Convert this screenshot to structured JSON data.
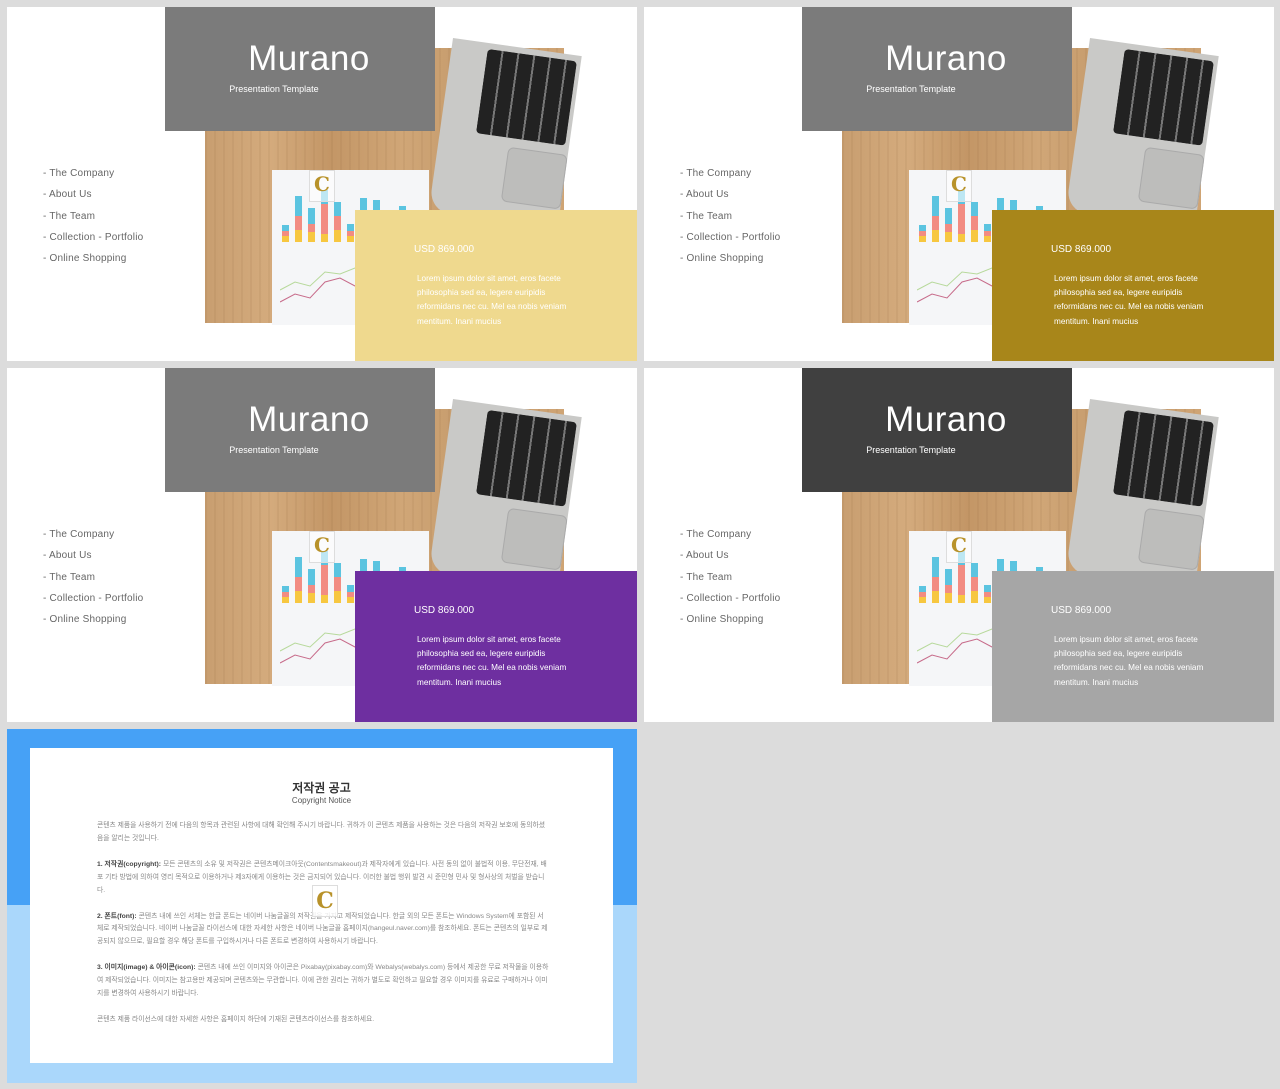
{
  "slides": [
    {
      "title": "Murano",
      "subtitle": "Presentation Template",
      "title_color": "#7b7b7b",
      "box_color": "#efd98e",
      "menu": [
        "- The Company",
        "- About Us",
        "- The Team",
        "- Collection - Portfolio",
        "- Online Shopping"
      ],
      "price": "USD 869.000",
      "description": "Lorem ipsum dolor sit amet, eros facete philosophia sed ea, legere euripidis reformidans nec cu. Mel ea nobis veniam mentitum. Inani mucius",
      "logo": "C"
    },
    {
      "title": "Murano",
      "subtitle": "Presentation Template",
      "title_color": "#7b7b7b",
      "box_color": "#a8861a",
      "menu": [
        "- The Company",
        "- About Us",
        "- The Team",
        "- Collection - Portfolio",
        "- Online Shopping"
      ],
      "price": "USD 869.000",
      "description": "Lorem ipsum dolor sit amet, eros facete philosophia sed ea, legere euripidis reformidans nec cu. Mel ea nobis veniam mentitum. Inani mucius",
      "logo": "C"
    },
    {
      "title": "Murano",
      "subtitle": "Presentation Template",
      "title_color": "#7b7b7b",
      "box_color": "#6e2fa0",
      "menu": [
        "- The Company",
        "- About Us",
        "- The Team",
        "- Collection - Portfolio",
        "- Online Shopping"
      ],
      "price": "USD 869.000",
      "description": "Lorem ipsum dolor sit amet, eros facete philosophia sed ea, legere euripidis reformidans nec cu. Mel ea nobis veniam mentitum. Inani mucius",
      "logo": "C"
    },
    {
      "title": "Murano",
      "subtitle": "Presentation Template",
      "title_color": "#404040",
      "box_color": "#a6a6a6",
      "menu": [
        "- The Company",
        "- About Us",
        "- The Team",
        "- Collection - Portfolio",
        "- Online Shopping"
      ],
      "price": "USD 869.000",
      "description": "Lorem ipsum dolor sit amet, eros facete philosophia sed ea, legere euripidis reformidans nec cu. Mel ea nobis veniam mentitum. Inani mucius",
      "logo": "C"
    }
  ],
  "notice": {
    "title": "저작권 공고",
    "subtitle": "Copyright Notice",
    "intro": "콘텐츠 제품을 사용하기 전에 다음의 항목과 관련된 사항에 대해 확인해 주시기 바랍니다. 귀하가 이 콘텐츠 제품을 사용하는 것은 다음의 저작권 보호에 동의하셨음을 알리는 것입니다.",
    "items": [
      {
        "label": "1. 저작권(copyright):",
        "text": " 모든 콘텐츠의 소유 및 저작권은 콘텐츠메이크아웃(Contentsmakeout)과 제작자에게 있습니다. 사전 동의 없이 불법적 이용, 무단전재, 배포 기타 방법에 의하여 영리 목적으로 이용하거나 제3자에게 이용하는 것은 금지되어 있습니다. 이러한 불법 행위 발견 시 준민형 민사 및 형사상의 처벌을 받습니다."
      },
      {
        "label": "2. 폰트(font):",
        "text": " 콘텐츠 내에 쓰인 서체는 한글 폰트는 네이버 나눔글꼴의 저작권을 가지고 제작되었습니다. 한글 외의 모든 폰트는 Windows System에 포함된 서체로 제작되었습니다. 네이버 나눔글꼴 라이선스에 대한 자세한 사항은 네이버 나눔글꼴 홈페이지(hangeul.naver.com)를 참조하세요. 폰트는 콘텐츠의 일부로 제공되지 않으므로, 필요할 경우 해당 폰트를 구입하시거나 다른 폰트로 변경하여 사용하시기 바랍니다."
      },
      {
        "label": "3. 이미지(image) & 아이콘(icon):",
        "text": " 콘텐츠 내에 쓰인 이미지와 아이콘은 Pixabay(pixabay.com)와 Webalys(webalys.com) 등에서 제공한 무료 저작물을 이용하여 제작되었습니다. 이미지는 참고용만 제공되며 콘텐츠와는 무관합니다. 이에 관한 권리는 귀하가 별도로 확인하고 필요할 경우 이미지를 유료로 구매하거나 이미지를 변경하여 사용하시기 바랍니다."
      }
    ],
    "footer": "콘텐츠 제품 라이선스에 대한 자세한 사항은 홈페이지 하단에 기재된 콘텐츠라이선스를 참조하세요.",
    "logo": "C",
    "top_color": "#46a1f6",
    "bottom_color": "#aad7fb"
  }
}
